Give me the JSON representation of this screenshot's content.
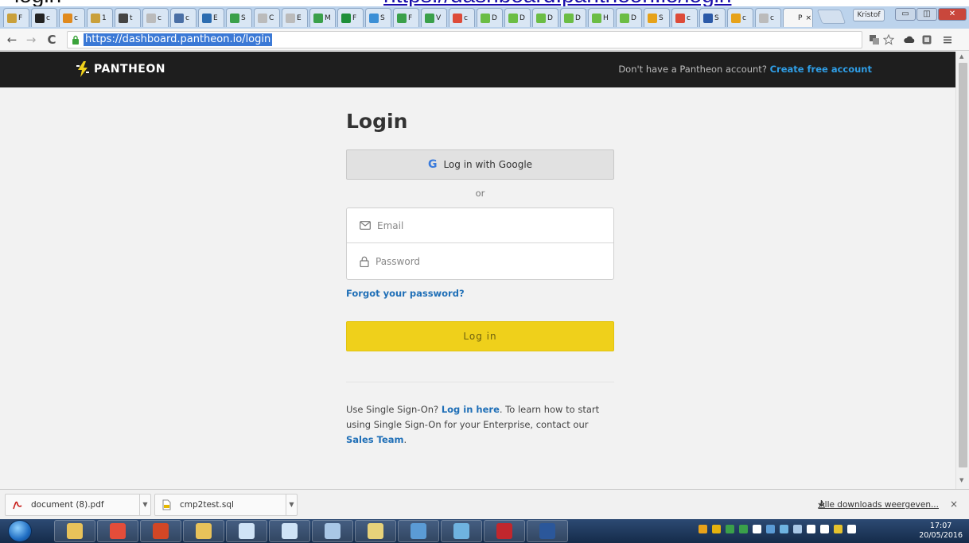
{
  "browser": {
    "tabs": [
      {
        "label": "F",
        "color": "#c9a03b"
      },
      {
        "label": "c",
        "color": "#222222"
      },
      {
        "label": "c",
        "color": "#e08a1e"
      },
      {
        "label": "1",
        "color": "#c9a03b"
      },
      {
        "label": "t",
        "color": "#444444"
      },
      {
        "label": "c",
        "color": "#bbbbbb"
      },
      {
        "label": "c",
        "color": "#4a6fa5"
      },
      {
        "label": "E",
        "color": "#2b6cb0"
      },
      {
        "label": "S",
        "color": "#3aa04a"
      },
      {
        "label": "C",
        "color": "#bbbbbb"
      },
      {
        "label": "E",
        "color": "#bbbbbb"
      },
      {
        "label": "M",
        "color": "#3aa04a"
      },
      {
        "label": "F",
        "color": "#1e8f3a"
      },
      {
        "label": "S",
        "color": "#3b8fd6"
      },
      {
        "label": "F",
        "color": "#3aa04a"
      },
      {
        "label": "V",
        "color": "#3aa04a"
      },
      {
        "label": "c",
        "color": "#dd4b39"
      },
      {
        "label": "D",
        "color": "#6bbd45"
      },
      {
        "label": "D",
        "color": "#6bbd45"
      },
      {
        "label": "D",
        "color": "#6bbd45"
      },
      {
        "label": "D",
        "color": "#6bbd45"
      },
      {
        "label": "H",
        "color": "#6bbd45"
      },
      {
        "label": "D",
        "color": "#6bbd45"
      },
      {
        "label": "S",
        "color": "#e6a21a"
      },
      {
        "label": "c",
        "color": "#dd4b39"
      },
      {
        "label": "S",
        "color": "#2b5aa8"
      },
      {
        "label": "c",
        "color": "#e6a21a"
      },
      {
        "label": "c",
        "color": "#bbbbbb"
      },
      {
        "label": "P",
        "color": "#f6f6f6",
        "active": true
      }
    ],
    "profile_name": "Kristof",
    "window_controls": {
      "minimize": "▭",
      "maximize": "◫",
      "close": "✕"
    },
    "nav": {
      "back": "←",
      "forward": "→",
      "reload": "C"
    },
    "url": "https://dashboard.pantheon.io/login"
  },
  "header": {
    "logo_text": "PANTHEON",
    "prompt": "Don't have a Pantheon account?",
    "create_account": "Create free account"
  },
  "login": {
    "title": "Login",
    "google_button": "Log in with Google",
    "google_icon_glyph": "G",
    "or": "or",
    "email_placeholder": "Email",
    "password_placeholder": "Password",
    "forgot_password": "Forgot your password?",
    "login_button": "Log in",
    "sso": {
      "prefix": "Use Single Sign-On?",
      "link": "Log in here",
      "middle": ". To learn how to start using Single Sign-On for your Enterprise, contact our",
      "sales_link": "Sales Team",
      "suffix": "."
    }
  },
  "downloads": {
    "items": [
      {
        "name": "document (8).pdf"
      },
      {
        "name": "cmp2test.sql"
      }
    ],
    "show_all": "Alle downloads weergeven...",
    "close": "×"
  },
  "taskbar": {
    "clock_time": "17:07",
    "clock_date": "20/05/2016",
    "apps": [
      {
        "name": "explorer",
        "color": "#e8c25a"
      },
      {
        "name": "chrome",
        "color": "#e44d3a"
      },
      {
        "name": "powerpoint",
        "color": "#d24726"
      },
      {
        "name": "apps-grid",
        "color": "#e8c25a"
      },
      {
        "name": "app-circle",
        "color": "#cfe3f6"
      },
      {
        "name": "lock-app",
        "color": "#cfe3f6"
      },
      {
        "name": "settings-app",
        "color": "#a9c7e6"
      },
      {
        "name": "notepad-app",
        "color": "#e7d27a"
      },
      {
        "name": "network-app",
        "color": "#5b9bd5"
      },
      {
        "name": "paint-app",
        "color": "#6fb3e0"
      },
      {
        "name": "filezilla",
        "color": "#c1272d"
      },
      {
        "name": "word",
        "color": "#2b579a"
      }
    ],
    "tray_colors": [
      "#e8a21a",
      "#e5b20e",
      "#3aa04a",
      "#3aa04a",
      "#ffffff",
      "#5b9bd5",
      "#6fb3e0",
      "#a9c7e6",
      "#ffffff",
      "#ffffff",
      "#e5c22e",
      "#ffffff"
    ]
  }
}
